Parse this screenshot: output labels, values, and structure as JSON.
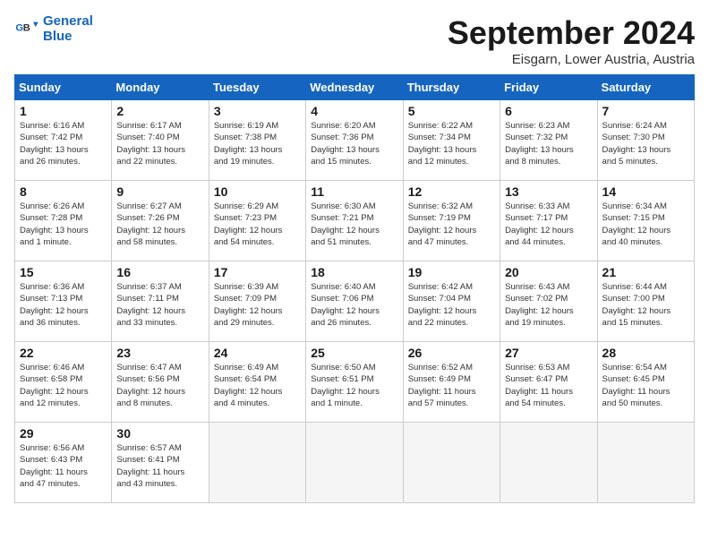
{
  "logo": {
    "name1": "General",
    "name2": "Blue"
  },
  "title": "September 2024",
  "subtitle": "Eisgarn, Lower Austria, Austria",
  "headers": [
    "Sunday",
    "Monday",
    "Tuesday",
    "Wednesday",
    "Thursday",
    "Friday",
    "Saturday"
  ],
  "days": [
    {
      "num": "",
      "info": ""
    },
    {
      "num": "2",
      "info": "Sunrise: 6:17 AM\nSunset: 7:40 PM\nDaylight: 13 hours\nand 22 minutes."
    },
    {
      "num": "3",
      "info": "Sunrise: 6:19 AM\nSunset: 7:38 PM\nDaylight: 13 hours\nand 19 minutes."
    },
    {
      "num": "4",
      "info": "Sunrise: 6:20 AM\nSunset: 7:36 PM\nDaylight: 13 hours\nand 15 minutes."
    },
    {
      "num": "5",
      "info": "Sunrise: 6:22 AM\nSunset: 7:34 PM\nDaylight: 13 hours\nand 12 minutes."
    },
    {
      "num": "6",
      "info": "Sunrise: 6:23 AM\nSunset: 7:32 PM\nDaylight: 13 hours\nand 8 minutes."
    },
    {
      "num": "7",
      "info": "Sunrise: 6:24 AM\nSunset: 7:30 PM\nDaylight: 13 hours\nand 5 minutes."
    },
    {
      "num": "8",
      "info": "Sunrise: 6:26 AM\nSunset: 7:28 PM\nDaylight: 13 hours\nand 1 minute."
    },
    {
      "num": "9",
      "info": "Sunrise: 6:27 AM\nSunset: 7:26 PM\nDaylight: 12 hours\nand 58 minutes."
    },
    {
      "num": "10",
      "info": "Sunrise: 6:29 AM\nSunset: 7:23 PM\nDaylight: 12 hours\nand 54 minutes."
    },
    {
      "num": "11",
      "info": "Sunrise: 6:30 AM\nSunset: 7:21 PM\nDaylight: 12 hours\nand 51 minutes."
    },
    {
      "num": "12",
      "info": "Sunrise: 6:32 AM\nSunset: 7:19 PM\nDaylight: 12 hours\nand 47 minutes."
    },
    {
      "num": "13",
      "info": "Sunrise: 6:33 AM\nSunset: 7:17 PM\nDaylight: 12 hours\nand 44 minutes."
    },
    {
      "num": "14",
      "info": "Sunrise: 6:34 AM\nSunset: 7:15 PM\nDaylight: 12 hours\nand 40 minutes."
    },
    {
      "num": "15",
      "info": "Sunrise: 6:36 AM\nSunset: 7:13 PM\nDaylight: 12 hours\nand 36 minutes."
    },
    {
      "num": "16",
      "info": "Sunrise: 6:37 AM\nSunset: 7:11 PM\nDaylight: 12 hours\nand 33 minutes."
    },
    {
      "num": "17",
      "info": "Sunrise: 6:39 AM\nSunset: 7:09 PM\nDaylight: 12 hours\nand 29 minutes."
    },
    {
      "num": "18",
      "info": "Sunrise: 6:40 AM\nSunset: 7:06 PM\nDaylight: 12 hours\nand 26 minutes."
    },
    {
      "num": "19",
      "info": "Sunrise: 6:42 AM\nSunset: 7:04 PM\nDaylight: 12 hours\nand 22 minutes."
    },
    {
      "num": "20",
      "info": "Sunrise: 6:43 AM\nSunset: 7:02 PM\nDaylight: 12 hours\nand 19 minutes."
    },
    {
      "num": "21",
      "info": "Sunrise: 6:44 AM\nSunset: 7:00 PM\nDaylight: 12 hours\nand 15 minutes."
    },
    {
      "num": "22",
      "info": "Sunrise: 6:46 AM\nSunset: 6:58 PM\nDaylight: 12 hours\nand 12 minutes."
    },
    {
      "num": "23",
      "info": "Sunrise: 6:47 AM\nSunset: 6:56 PM\nDaylight: 12 hours\nand 8 minutes."
    },
    {
      "num": "24",
      "info": "Sunrise: 6:49 AM\nSunset: 6:54 PM\nDaylight: 12 hours\nand 4 minutes."
    },
    {
      "num": "25",
      "info": "Sunrise: 6:50 AM\nSunset: 6:51 PM\nDaylight: 12 hours\nand 1 minute."
    },
    {
      "num": "26",
      "info": "Sunrise: 6:52 AM\nSunset: 6:49 PM\nDaylight: 11 hours\nand 57 minutes."
    },
    {
      "num": "27",
      "info": "Sunrise: 6:53 AM\nSunset: 6:47 PM\nDaylight: 11 hours\nand 54 minutes."
    },
    {
      "num": "28",
      "info": "Sunrise: 6:54 AM\nSunset: 6:45 PM\nDaylight: 11 hours\nand 50 minutes."
    },
    {
      "num": "29",
      "info": "Sunrise: 6:56 AM\nSunset: 6:43 PM\nDaylight: 11 hours\nand 47 minutes."
    },
    {
      "num": "30",
      "info": "Sunrise: 6:57 AM\nSunset: 6:41 PM\nDaylight: 11 hours\nand 43 minutes."
    }
  ],
  "day1": {
    "num": "1",
    "info": "Sunrise: 6:16 AM\nSunset: 7:42 PM\nDaylight: 13 hours\nand 26 minutes."
  }
}
